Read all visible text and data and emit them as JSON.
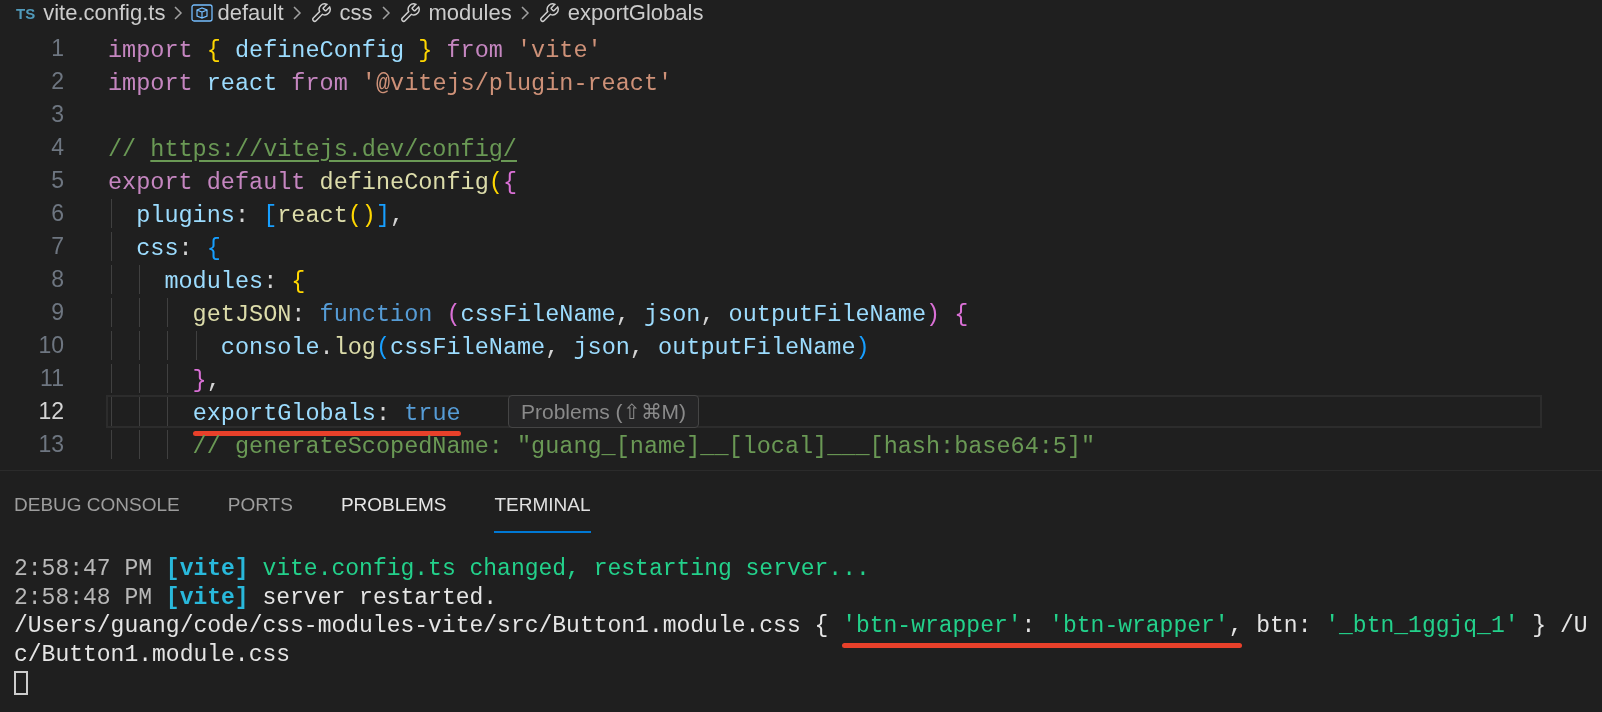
{
  "breadcrumb": [
    {
      "kind": "file",
      "icon_text": "TS",
      "label": "vite.config.ts"
    },
    {
      "kind": "variable",
      "label": "default"
    },
    {
      "kind": "property",
      "label": "css"
    },
    {
      "kind": "property",
      "label": "modules"
    },
    {
      "kind": "property",
      "label": "exportGlobals"
    }
  ],
  "editor": {
    "lines": [
      {
        "number": "1",
        "current": false,
        "tokens": [
          {
            "t": "import ",
            "color": "#c586c0"
          },
          {
            "t": "{",
            "color": "#ffd700"
          },
          {
            "t": " defineConfig ",
            "color": "#9cdcfe"
          },
          {
            "t": "}",
            "color": "#ffd700"
          },
          {
            "t": " from",
            "color": "#c586c0"
          },
          {
            "t": " 'vite'",
            "color": "#ce9178"
          }
        ]
      },
      {
        "number": "2",
        "current": false,
        "tokens": [
          {
            "t": "import",
            "color": "#c586c0"
          },
          {
            "t": " react ",
            "color": "#9cdcfe"
          },
          {
            "t": "from",
            "color": "#c586c0"
          },
          {
            "t": " '@vitejs/plugin-react'",
            "color": "#ce9178"
          }
        ]
      },
      {
        "number": "3",
        "current": false
      },
      {
        "number": "4",
        "current": false,
        "tokens": [
          {
            "t": "// ",
            "color": "#6a9955"
          },
          {
            "t": "https://vitejs.dev/config/",
            "color": "#6a9955",
            "link": true
          }
        ]
      },
      {
        "number": "5",
        "current": false,
        "tokens": [
          {
            "t": "export default ",
            "color": "#c586c0"
          },
          {
            "t": "defineConfig",
            "color": "#dcdcaa"
          },
          {
            "t": "(",
            "color": "#ffd700"
          },
          {
            "t": "{",
            "color": "#da70d6"
          }
        ]
      },
      {
        "number": "6",
        "current": false,
        "tokens": [
          {
            "t": "  plugins",
            "color": "#9cdcfe"
          },
          {
            "t": ": ",
            "color": "#d4d4d4"
          },
          {
            "t": "[",
            "color": "#179fff"
          },
          {
            "t": "react",
            "color": "#dcdcaa"
          },
          {
            "t": "()",
            "color": "#ffd700"
          },
          {
            "t": "]",
            "color": "#179fff"
          },
          {
            "t": ",",
            "color": "#d4d4d4"
          }
        ]
      },
      {
        "number": "7",
        "current": false,
        "tokens": [
          {
            "t": "  css",
            "color": "#9cdcfe"
          },
          {
            "t": ": ",
            "color": "#d4d4d4"
          },
          {
            "t": "{",
            "color": "#179fff"
          }
        ]
      },
      {
        "number": "8",
        "current": false,
        "tokens": [
          {
            "t": "    modules",
            "color": "#9cdcfe"
          },
          {
            "t": ": ",
            "color": "#d4d4d4"
          },
          {
            "t": "{",
            "color": "#ffd700"
          }
        ]
      },
      {
        "number": "9",
        "current": false,
        "tokens": [
          {
            "t": "      getJSON",
            "color": "#dcdcaa"
          },
          {
            "t": ": ",
            "color": "#d4d4d4"
          },
          {
            "t": "function ",
            "color": "#569cd6"
          },
          {
            "t": "(",
            "color": "#da70d6"
          },
          {
            "t": "cssFileName",
            "color": "#9cdcfe"
          },
          {
            "t": ", ",
            "color": "#d4d4d4"
          },
          {
            "t": "json",
            "color": "#9cdcfe"
          },
          {
            "t": ", ",
            "color": "#d4d4d4"
          },
          {
            "t": "outputFileName",
            "color": "#9cdcfe"
          },
          {
            "t": ")",
            "color": "#da70d6"
          },
          {
            "t": " {",
            "color": "#da70d6"
          }
        ]
      },
      {
        "number": "10",
        "current": false,
        "tokens": [
          {
            "t": "        console",
            "color": "#9cdcfe"
          },
          {
            "t": ".",
            "color": "#d4d4d4"
          },
          {
            "t": "log",
            "color": "#dcdcaa"
          },
          {
            "t": "(",
            "color": "#179fff"
          },
          {
            "t": "cssFileName",
            "color": "#9cdcfe"
          },
          {
            "t": ", ",
            "color": "#d4d4d4"
          },
          {
            "t": "json",
            "color": "#9cdcfe"
          },
          {
            "t": ", ",
            "color": "#d4d4d4"
          },
          {
            "t": "outputFileName",
            "color": "#9cdcfe"
          },
          {
            "t": ")",
            "color": "#179fff"
          }
        ]
      },
      {
        "number": "11",
        "current": false,
        "tokens": [
          {
            "t": "      }",
            "color": "#da70d6"
          },
          {
            "t": ",",
            "color": "#d4d4d4"
          }
        ]
      },
      {
        "number": "12",
        "current": true,
        "tokens": [
          {
            "t": "      exportGlobals",
            "color": "#9cdcfe",
            "marked": true
          },
          {
            "t": ": ",
            "color": "#d4d4d4",
            "marked": true
          },
          {
            "t": "true",
            "color": "#569cd6",
            "marked": true
          }
        ]
      },
      {
        "number": "13",
        "current": false,
        "tokens": [
          {
            "t": "      // generateScopedName: \"guang_[name]__[local]___[hash:base64:5]\"",
            "color": "#6a9955"
          }
        ]
      }
    ],
    "tooltip": "Problems (⇧⌘M)"
  },
  "panel": {
    "tabs": [
      {
        "label": "DEBUG CONSOLE",
        "selected": false,
        "hovered": false
      },
      {
        "label": "PORTS",
        "selected": false,
        "hovered": false
      },
      {
        "label": "PROBLEMS",
        "selected": false,
        "hovered": true
      },
      {
        "label": "TERMINAL",
        "selected": true,
        "hovered": false
      }
    ],
    "terminal": {
      "lines": [
        [
          {
            "t": "2:58:47 PM ",
            "color": "#b8b8b8"
          },
          {
            "t": "**[vite]**",
            "color": "#29b8db"
          },
          {
            "t": " vite.config.ts changed, restarting server...",
            "color": "#23d18b"
          }
        ],
        [
          {
            "t": "2:58:48 PM ",
            "color": "#b8b8b8"
          },
          {
            "t": "**[vite]**",
            "color": "#29b8db"
          },
          {
            "t": " server restarted.",
            "color": "#e5e5e5"
          }
        ],
        [
          {
            "t": "/Users/guang/code/css-modules-vite/src/Button1.module.css { ",
            "color": "#e5e5e5"
          },
          {
            "t": "'btn-wrapper'",
            "color": "#23d18b",
            "marked": true
          },
          {
            "t": ": ",
            "color": "#e5e5e5",
            "marked": true
          },
          {
            "t": "'btn-wrapper'",
            "color": "#23d18b",
            "marked": true
          },
          {
            "t": ",",
            "color": "#e5e5e5",
            "marked": true
          },
          {
            "t": " btn: ",
            "color": "#e5e5e5"
          },
          {
            "t": "'_btn_1ggjq_1'",
            "color": "#23d18b"
          },
          {
            "t": " } /U",
            "color": "#e5e5e5"
          }
        ],
        [
          {
            "t": "c/Button1.module.css",
            "color": "#e5e5e5"
          }
        ]
      ],
      "cursor": true
    }
  }
}
